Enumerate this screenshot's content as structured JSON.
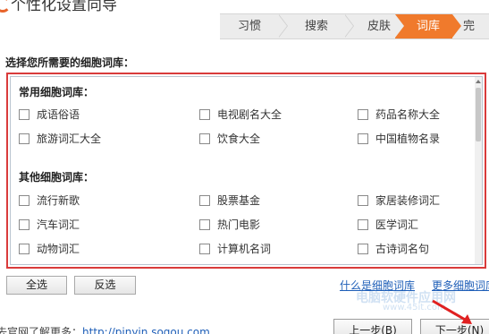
{
  "header": {
    "title": "个性化设置向导",
    "steps": [
      "习惯",
      "搜索",
      "皮肤",
      "词库",
      "完"
    ],
    "active_step_index": 3,
    "accent_color": "#f07a2c"
  },
  "prompt": "选择您所需要的细胞词库：",
  "sections": [
    {
      "title": "常用细胞词库：",
      "items": [
        "成语俗语",
        "电视剧名大全",
        "药品名称大全",
        "旅游词汇大全",
        "饮食大全",
        "中国植物名录"
      ]
    },
    {
      "title": "其他细胞词库：",
      "items": [
        "流行新歌",
        "股票基金",
        "家居装修词汇",
        "汽车词汇",
        "热门电影",
        "医学词汇",
        "动物词汇",
        "计算机名词",
        "古诗词名句"
      ]
    }
  ],
  "buttons": {
    "select_all": "全选",
    "invert": "反选",
    "prev": "上一步(B)",
    "next": "下一步(N)"
  },
  "links": {
    "what_is": "什么是细胞词库",
    "more": "更多细胞词库"
  },
  "footer": {
    "text": "去官网了解更多：",
    "url": "http://pinyin.sogou.com"
  },
  "watermark": {
    "line1": "电脑软硬件应用网",
    "line2": "www.45it.com"
  },
  "border_color": "#d93b3b"
}
